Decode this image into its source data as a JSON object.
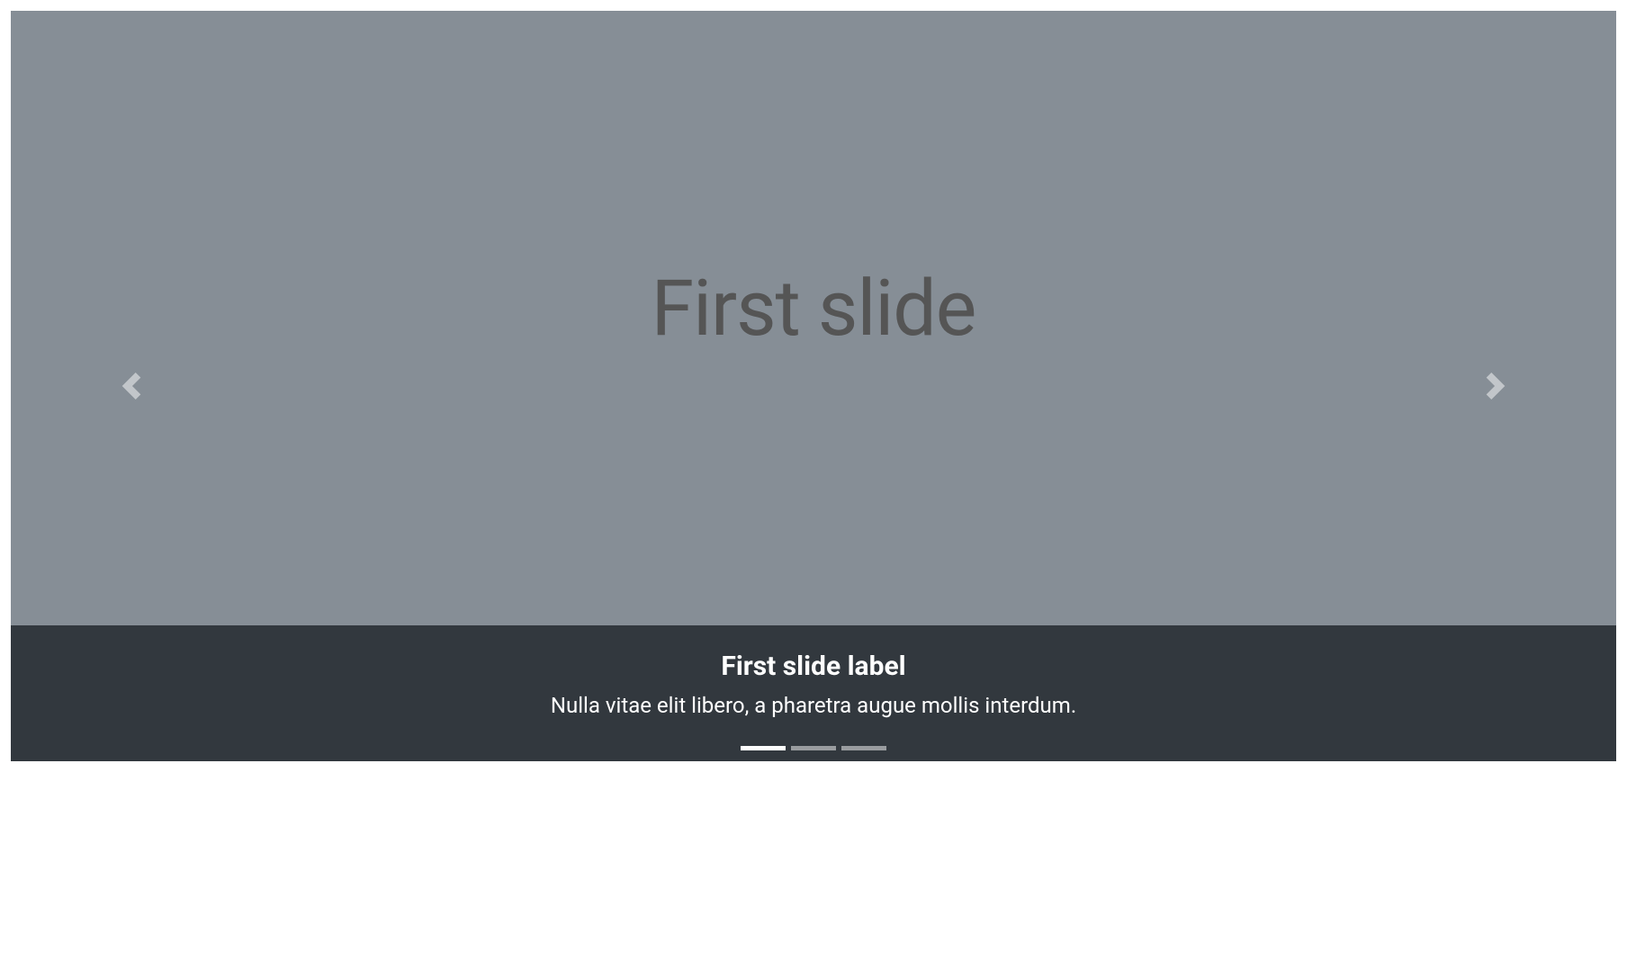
{
  "carousel": {
    "slides": [
      {
        "image_text": "First slide",
        "caption_title": "First slide label",
        "caption_text": "Nulla vitae elit libero, a pharetra augue mollis interdum."
      }
    ],
    "controls": {
      "prev_label": "Previous",
      "next_label": "Next"
    },
    "indicator_count": 3,
    "active_index": 0
  }
}
